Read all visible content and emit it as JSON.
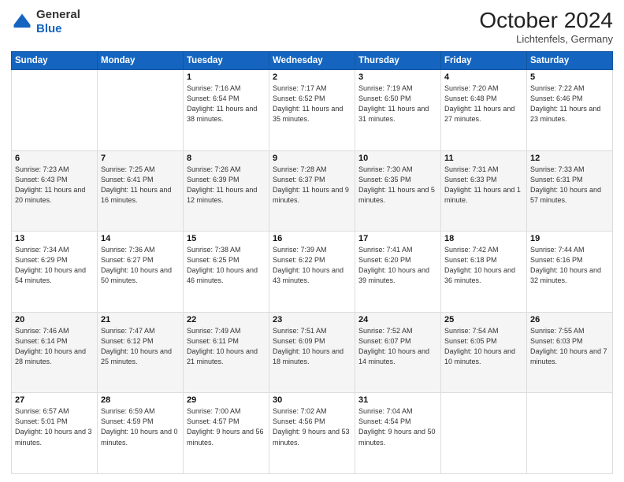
{
  "header": {
    "logo": {
      "general": "General",
      "blue": "Blue"
    },
    "title": "October 2024",
    "location": "Lichtenfels, Germany"
  },
  "days_of_week": [
    "Sunday",
    "Monday",
    "Tuesday",
    "Wednesday",
    "Thursday",
    "Friday",
    "Saturday"
  ],
  "weeks": [
    [
      {
        "day": "",
        "detail": ""
      },
      {
        "day": "",
        "detail": ""
      },
      {
        "day": "1",
        "detail": "Sunrise: 7:16 AM\nSunset: 6:54 PM\nDaylight: 11 hours\nand 38 minutes."
      },
      {
        "day": "2",
        "detail": "Sunrise: 7:17 AM\nSunset: 6:52 PM\nDaylight: 11 hours\nand 35 minutes."
      },
      {
        "day": "3",
        "detail": "Sunrise: 7:19 AM\nSunset: 6:50 PM\nDaylight: 11 hours\nand 31 minutes."
      },
      {
        "day": "4",
        "detail": "Sunrise: 7:20 AM\nSunset: 6:48 PM\nDaylight: 11 hours\nand 27 minutes."
      },
      {
        "day": "5",
        "detail": "Sunrise: 7:22 AM\nSunset: 6:46 PM\nDaylight: 11 hours\nand 23 minutes."
      }
    ],
    [
      {
        "day": "6",
        "detail": "Sunrise: 7:23 AM\nSunset: 6:43 PM\nDaylight: 11 hours\nand 20 minutes."
      },
      {
        "day": "7",
        "detail": "Sunrise: 7:25 AM\nSunset: 6:41 PM\nDaylight: 11 hours\nand 16 minutes."
      },
      {
        "day": "8",
        "detail": "Sunrise: 7:26 AM\nSunset: 6:39 PM\nDaylight: 11 hours\nand 12 minutes."
      },
      {
        "day": "9",
        "detail": "Sunrise: 7:28 AM\nSunset: 6:37 PM\nDaylight: 11 hours\nand 9 minutes."
      },
      {
        "day": "10",
        "detail": "Sunrise: 7:30 AM\nSunset: 6:35 PM\nDaylight: 11 hours\nand 5 minutes."
      },
      {
        "day": "11",
        "detail": "Sunrise: 7:31 AM\nSunset: 6:33 PM\nDaylight: 11 hours\nand 1 minute."
      },
      {
        "day": "12",
        "detail": "Sunrise: 7:33 AM\nSunset: 6:31 PM\nDaylight: 10 hours\nand 57 minutes."
      }
    ],
    [
      {
        "day": "13",
        "detail": "Sunrise: 7:34 AM\nSunset: 6:29 PM\nDaylight: 10 hours\nand 54 minutes."
      },
      {
        "day": "14",
        "detail": "Sunrise: 7:36 AM\nSunset: 6:27 PM\nDaylight: 10 hours\nand 50 minutes."
      },
      {
        "day": "15",
        "detail": "Sunrise: 7:38 AM\nSunset: 6:25 PM\nDaylight: 10 hours\nand 46 minutes."
      },
      {
        "day": "16",
        "detail": "Sunrise: 7:39 AM\nSunset: 6:22 PM\nDaylight: 10 hours\nand 43 minutes."
      },
      {
        "day": "17",
        "detail": "Sunrise: 7:41 AM\nSunset: 6:20 PM\nDaylight: 10 hours\nand 39 minutes."
      },
      {
        "day": "18",
        "detail": "Sunrise: 7:42 AM\nSunset: 6:18 PM\nDaylight: 10 hours\nand 36 minutes."
      },
      {
        "day": "19",
        "detail": "Sunrise: 7:44 AM\nSunset: 6:16 PM\nDaylight: 10 hours\nand 32 minutes."
      }
    ],
    [
      {
        "day": "20",
        "detail": "Sunrise: 7:46 AM\nSunset: 6:14 PM\nDaylight: 10 hours\nand 28 minutes."
      },
      {
        "day": "21",
        "detail": "Sunrise: 7:47 AM\nSunset: 6:12 PM\nDaylight: 10 hours\nand 25 minutes."
      },
      {
        "day": "22",
        "detail": "Sunrise: 7:49 AM\nSunset: 6:11 PM\nDaylight: 10 hours\nand 21 minutes."
      },
      {
        "day": "23",
        "detail": "Sunrise: 7:51 AM\nSunset: 6:09 PM\nDaylight: 10 hours\nand 18 minutes."
      },
      {
        "day": "24",
        "detail": "Sunrise: 7:52 AM\nSunset: 6:07 PM\nDaylight: 10 hours\nand 14 minutes."
      },
      {
        "day": "25",
        "detail": "Sunrise: 7:54 AM\nSunset: 6:05 PM\nDaylight: 10 hours\nand 10 minutes."
      },
      {
        "day": "26",
        "detail": "Sunrise: 7:55 AM\nSunset: 6:03 PM\nDaylight: 10 hours\nand 7 minutes."
      }
    ],
    [
      {
        "day": "27",
        "detail": "Sunrise: 6:57 AM\nSunset: 5:01 PM\nDaylight: 10 hours\nand 3 minutes."
      },
      {
        "day": "28",
        "detail": "Sunrise: 6:59 AM\nSunset: 4:59 PM\nDaylight: 10 hours\nand 0 minutes."
      },
      {
        "day": "29",
        "detail": "Sunrise: 7:00 AM\nSunset: 4:57 PM\nDaylight: 9 hours\nand 56 minutes."
      },
      {
        "day": "30",
        "detail": "Sunrise: 7:02 AM\nSunset: 4:56 PM\nDaylight: 9 hours\nand 53 minutes."
      },
      {
        "day": "31",
        "detail": "Sunrise: 7:04 AM\nSunset: 4:54 PM\nDaylight: 9 hours\nand 50 minutes."
      },
      {
        "day": "",
        "detail": ""
      },
      {
        "day": "",
        "detail": ""
      }
    ]
  ]
}
